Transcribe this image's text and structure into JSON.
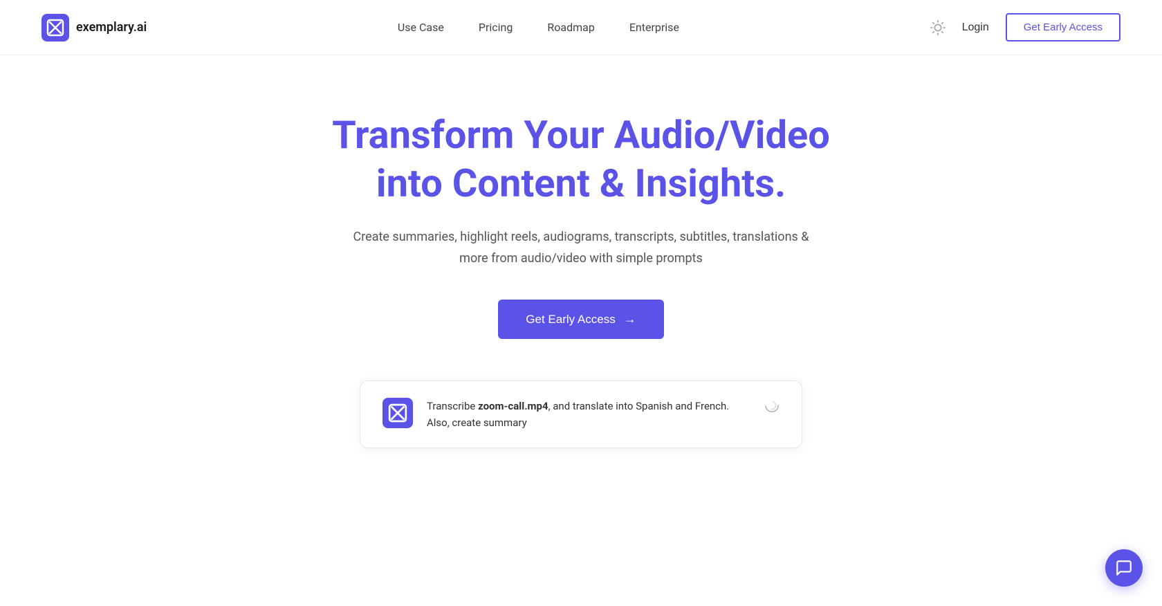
{
  "brand": {
    "name": "exemplary.ai"
  },
  "nav": {
    "links": [
      {
        "label": "Use Case",
        "key": "use-case"
      },
      {
        "label": "Pricing",
        "key": "pricing"
      },
      {
        "label": "Roadmap",
        "key": "roadmap"
      },
      {
        "label": "Enterprise",
        "key": "enterprise"
      }
    ],
    "login_label": "Login",
    "early_access_label": "Get Early Access"
  },
  "hero": {
    "title": "Transform Your Audio/Video into Content & Insights.",
    "subtitle": "Create summaries, highlight reels, audiograms, transcripts, subtitles, translations & more from audio/video with simple prompts",
    "cta_label": "Get Early Access",
    "arrow": "→"
  },
  "demo": {
    "text_before": "Transcribe ",
    "filename": "zoom-call.mp4",
    "text_after": ", and translate into Spanish and French. Also, create summary"
  },
  "colors": {
    "brand": "#5b52e8",
    "text_dark": "#1a1a1a",
    "text_medium": "#555555"
  }
}
